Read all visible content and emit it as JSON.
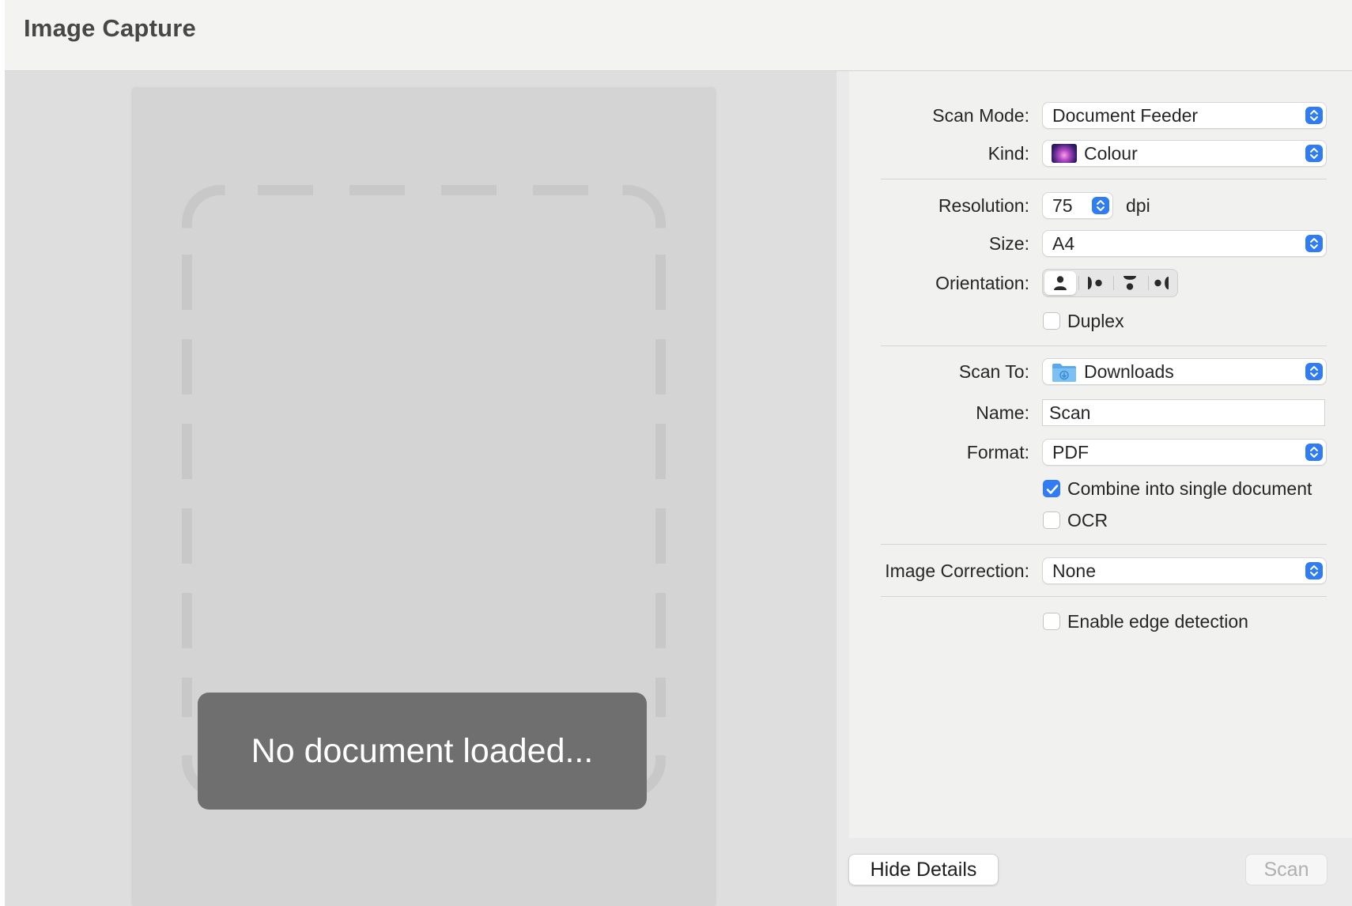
{
  "window": {
    "title": "Image Capture"
  },
  "preview": {
    "message": "No document loaded..."
  },
  "settings": {
    "scan_mode": {
      "label": "Scan Mode:",
      "value": "Document Feeder"
    },
    "kind": {
      "label": "Kind:",
      "value": "Colour",
      "icon": "colour-swatch-icon"
    },
    "resolution": {
      "label": "Resolution:",
      "value": "75",
      "unit": "dpi"
    },
    "size": {
      "label": "Size:",
      "value": "A4"
    },
    "orientation": {
      "label": "Orientation:",
      "options": [
        "portrait-icon",
        "rotate-left-icon",
        "upside-down-icon",
        "rotate-right-icon"
      ],
      "selected_index": 0
    },
    "duplex": {
      "label": "Duplex",
      "checked": false
    },
    "scan_to": {
      "label": "Scan To:",
      "value": "Downloads",
      "icon": "downloads-folder-icon"
    },
    "name": {
      "label": "Name:",
      "value": "Scan"
    },
    "format": {
      "label": "Format:",
      "value": "PDF"
    },
    "combine": {
      "label": "Combine into single document",
      "checked": true
    },
    "ocr": {
      "label": "OCR",
      "checked": false
    },
    "image_correction": {
      "label": "Image Correction:",
      "value": "None"
    },
    "edge_detection": {
      "label": "Enable edge detection",
      "checked": false
    }
  },
  "footer": {
    "hide_details_label": "Hide Details",
    "scan_label": "Scan",
    "scan_enabled": false
  },
  "colors": {
    "accent": "#2f7cf6",
    "placeholder_box": "#6f6f6f",
    "panel": "#f1f1f0",
    "preview_bg": "#dedede"
  }
}
